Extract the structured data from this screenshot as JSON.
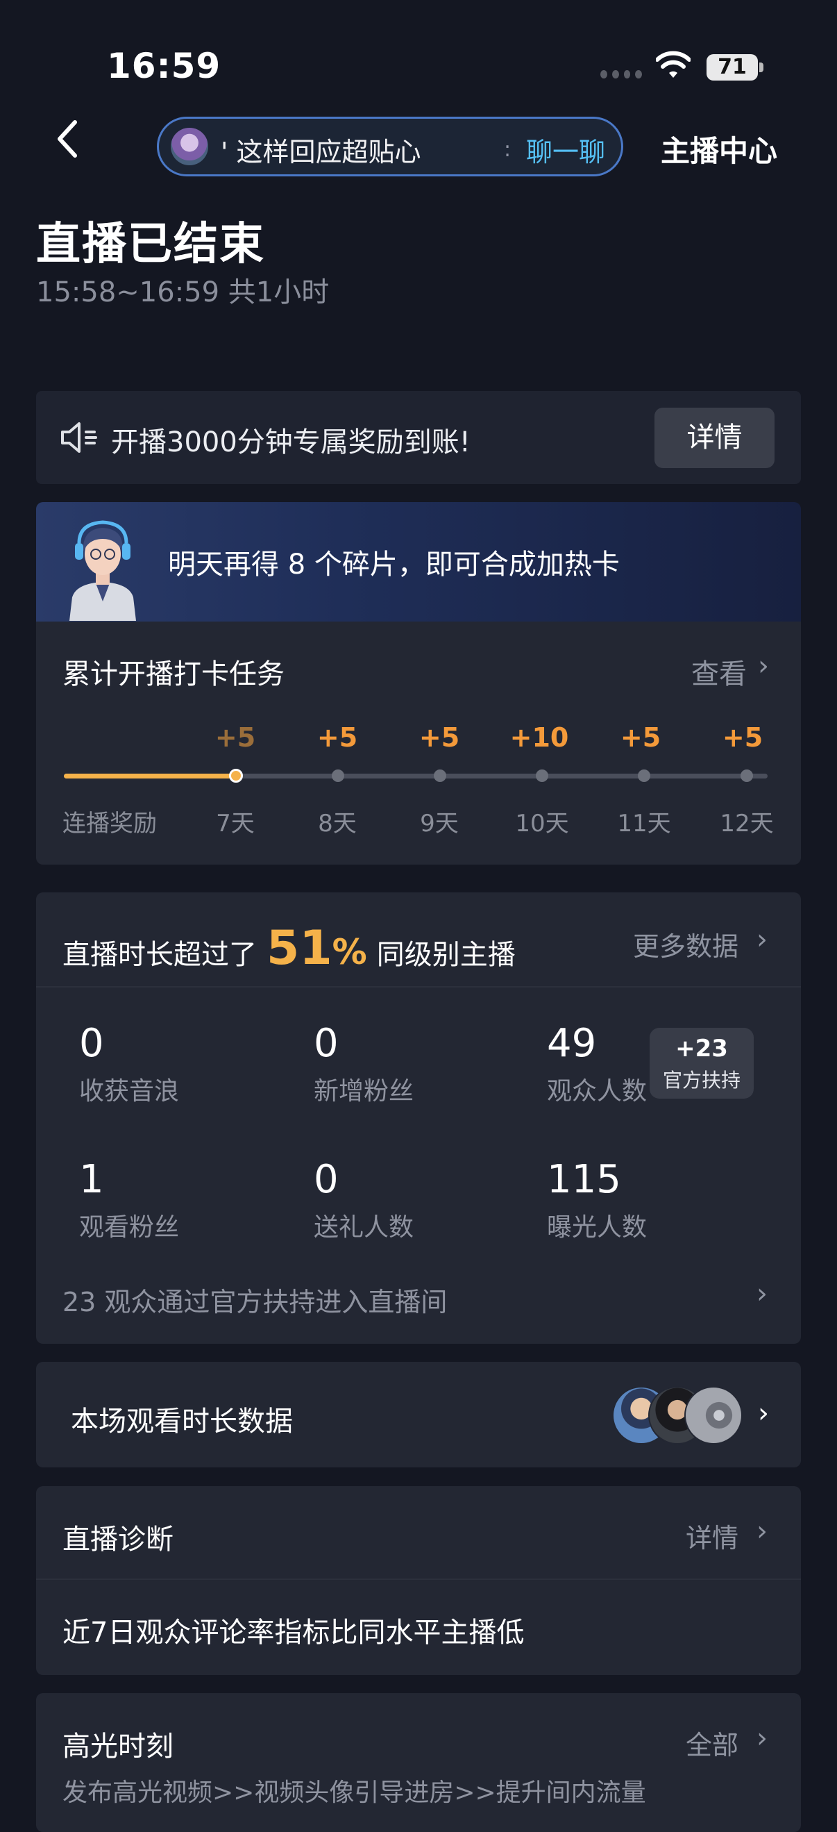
{
  "status_bar": {
    "time": "16:59",
    "battery": "71"
  },
  "nav": {
    "chat_text": "' 这样回应超贴心",
    "chat_separator": ":",
    "chat_action": "聊一聊",
    "host_center": "主播中心"
  },
  "header": {
    "title": "直播已结束",
    "subtitle": "15:58~16:59 共1小时"
  },
  "notice": {
    "text": "开播3000分钟专属奖励到账!",
    "button": "详情"
  },
  "banner": {
    "text": "明天再得 8 个碎片，即可合成加热卡"
  },
  "tasks": {
    "title": "累计开播打卡任务",
    "view": "查看",
    "start_label": "连播奖励",
    "progress": 0.24,
    "steps": [
      {
        "reward": "+5",
        "day": "7天"
      },
      {
        "reward": "+5",
        "day": "8天"
      },
      {
        "reward": "+5",
        "day": "9天"
      },
      {
        "reward": "+10",
        "day": "10天"
      },
      {
        "reward": "+5",
        "day": "11天"
      },
      {
        "reward": "+5",
        "day": "12天"
      }
    ]
  },
  "stats": {
    "headline_pre": "直播时长超过了",
    "headline_num": "51",
    "headline_pct": "%",
    "headline_post": "同级别主播",
    "more": "更多数据",
    "items": [
      {
        "value": "0",
        "label": "收获音浪"
      },
      {
        "value": "0",
        "label": "新增粉丝"
      },
      {
        "value": "49",
        "label": "观众人数"
      },
      {
        "value": "1",
        "label": "观看粉丝"
      },
      {
        "value": "0",
        "label": "送礼人数"
      },
      {
        "value": "115",
        "label": "曝光人数"
      }
    ],
    "boost_value": "+23",
    "boost_label": "官方扶持",
    "footer": "23 观众通过官方扶持进入直播间"
  },
  "watch": {
    "label": "本场观看时长数据"
  },
  "diagnosis": {
    "title": "直播诊断",
    "detail": "详情",
    "text": "近7日观众评论率指标比同水平主播低"
  },
  "highlights": {
    "title": "高光时刻",
    "all": "全部",
    "text": "发布高光视频>>视频头像引导进房>>提升间内流量"
  },
  "colors": {
    "accent": "#f5b24a",
    "link": "#55bff4",
    "background": "#141722"
  }
}
